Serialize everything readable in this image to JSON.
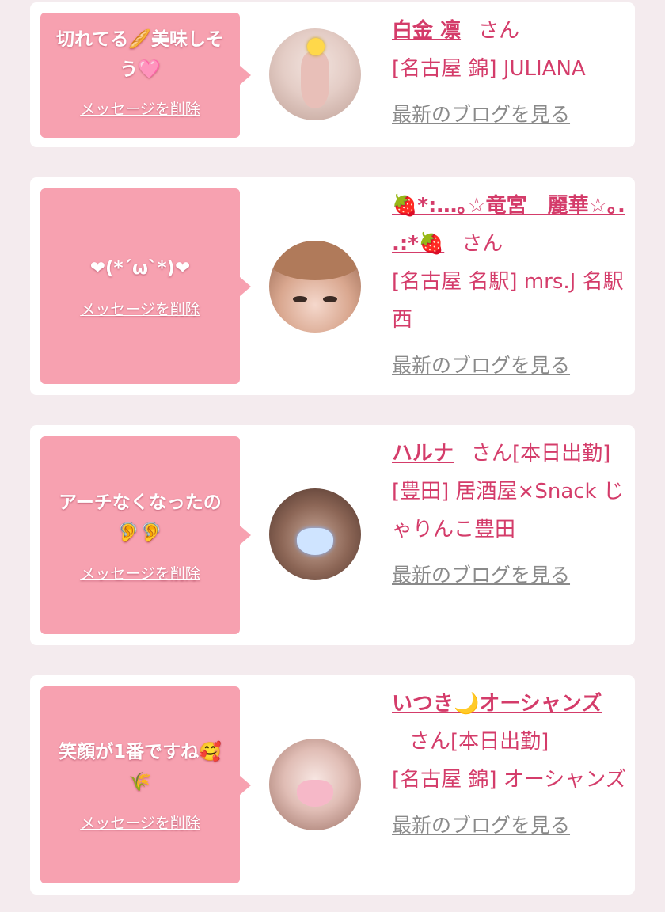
{
  "cards": [
    {
      "message": "切れてる🥖美味しそう🩷",
      "delete_label": "メッセージを削除",
      "name": "白金 凛",
      "honorific": "さん",
      "status": "",
      "shop": "[名古屋 錦] JULIANA",
      "blog_link": "最新のブログを見る"
    },
    {
      "message": "❤(*´ω`*)❤",
      "delete_label": "メッセージを削除",
      "name": "🍓*:…｡☆竜宮　麗華☆｡. .:*🍓",
      "honorific": "さん",
      "status": "",
      "shop": "[名古屋 名駅] mrs.J 名駅西",
      "blog_link": "最新のブログを見る"
    },
    {
      "message": "アーチなくなったの🦻🦻",
      "delete_label": "メッセージを削除",
      "name": "ハルナ",
      "honorific": "さん",
      "status": "[本日出勤]",
      "shop": "[豊田] 居酒屋×Snack じゃりんこ豊田",
      "blog_link": "最新のブログを見る"
    },
    {
      "message": "笑顔が1番ですね🥰🌾",
      "delete_label": "メッセージを削除",
      "name": "いつき🌙オーシャンズ",
      "honorific": "さん",
      "status": "[本日出勤]",
      "shop": "[名古屋 錦] オーシャンズ",
      "blog_link": "最新のブログを見る"
    }
  ]
}
